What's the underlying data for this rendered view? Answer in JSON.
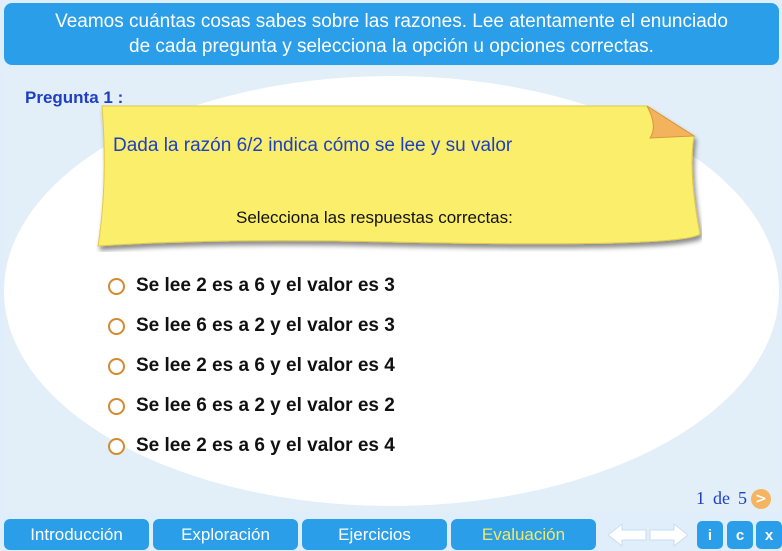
{
  "header": {
    "line1": "Veamos cuántas cosas sabes sobre las razones. Lee atentamente el enunciado",
    "line2": "de cada pregunta y selecciona la opción u opciones correctas."
  },
  "question": {
    "label": "Pregunta  1 :",
    "text": "Dada la razón 6/2 indica cómo se lee y su valor",
    "instruction": "Selecciona las respuestas correctas:"
  },
  "options": [
    {
      "label": "Se lee 2 es a 6 y el valor es 3"
    },
    {
      "label": "Se lee 6 es a 2 y el valor es 3"
    },
    {
      "label": "Se lee 2 es a 6 y el valor es 4"
    },
    {
      "label": "Se lee 6 es a 2 y el valor es 2"
    },
    {
      "label": "Se lee 2 es a 6 y el valor es 4"
    }
  ],
  "pager": {
    "current": "1",
    "of": "de",
    "total": "5",
    "next_glyph": ">"
  },
  "nav": {
    "tabs": [
      {
        "label": "Introducción"
      },
      {
        "label": "Exploración"
      },
      {
        "label": "Ejercicios"
      },
      {
        "label": "Evaluación"
      }
    ],
    "active_tab": "Evaluación",
    "buttons": {
      "info": "i",
      "credits": "c",
      "exit": "x"
    }
  },
  "colors": {
    "accent": "#2a9ee8",
    "question_blue": "#1d3fc4",
    "note_yellow": "#fbee6b",
    "radio_orange": "#d68a2e",
    "active_tab_text": "#f2e96a"
  }
}
